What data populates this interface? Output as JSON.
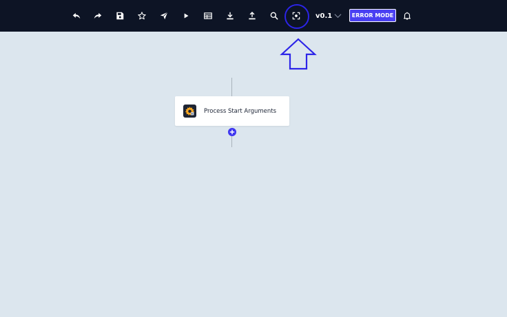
{
  "toolbar": {
    "buttons": [
      {
        "name": "undo-icon"
      },
      {
        "name": "redo-icon"
      },
      {
        "name": "save-icon"
      },
      {
        "name": "star-icon"
      },
      {
        "name": "send-icon"
      },
      {
        "name": "play-icon"
      },
      {
        "name": "table-icon"
      },
      {
        "name": "download-icon"
      },
      {
        "name": "upload-icon"
      },
      {
        "name": "search-icon"
      },
      {
        "name": "focus-icon"
      }
    ],
    "version_label": "v0.1",
    "error_mode_label": "ERROR MODE",
    "notification_icon": "bell-icon"
  },
  "canvas": {
    "node": {
      "label": "Process Start Arguments",
      "icon": "gear-icon"
    },
    "add_icon": "plus-icon"
  },
  "colors": {
    "toolbar_bg": "#0d1425",
    "canvas_bg": "#dce6ee",
    "accent": "#4a40f2",
    "annotation": "#2c24e8"
  }
}
